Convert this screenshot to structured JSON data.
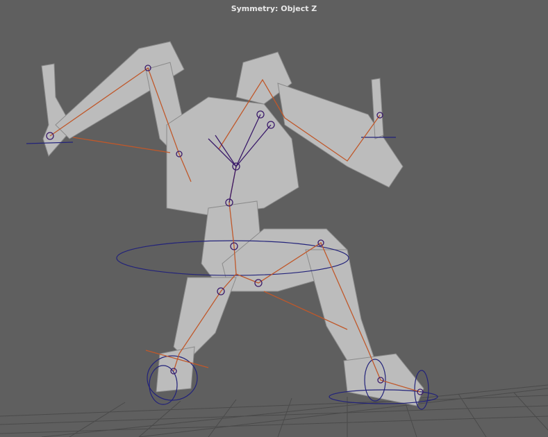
{
  "viewport": {
    "hud_text": "Symmetry: Object Z",
    "colors": {
      "background": "#5f5f5f",
      "mesh": "#bdbdbd",
      "bones": "#c0582a",
      "controls": "#22227a"
    }
  }
}
